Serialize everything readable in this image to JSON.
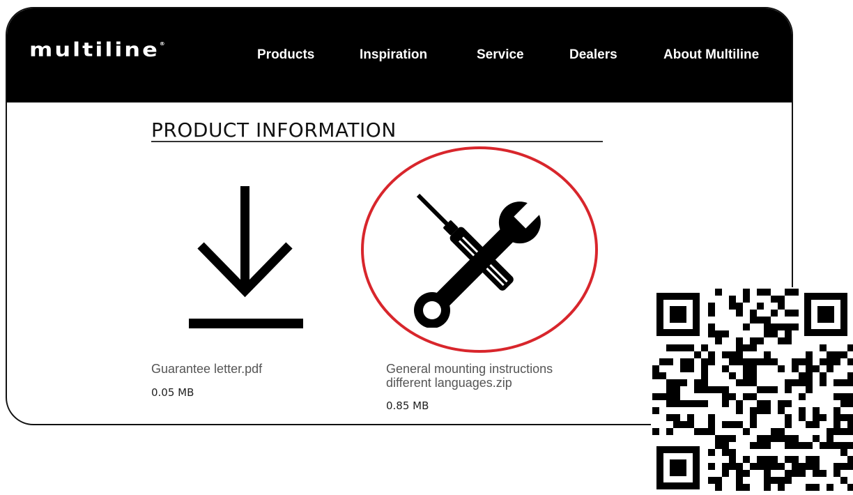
{
  "header": {
    "logo": "multiline",
    "logo_mark": "®",
    "nav": [
      "Products",
      "Inspiration",
      "Service",
      "Dealers",
      "About Multiline"
    ]
  },
  "section": {
    "title": "PRODUCT INFORMATION"
  },
  "files": [
    {
      "name": "Guarantee letter.pdf",
      "size": "0.05 MB",
      "icon": "download-icon"
    },
    {
      "name_line1": "General mounting instructions",
      "name_line2": "different languages.zip",
      "size": "0.85 MB",
      "icon": "tools-icon"
    }
  ],
  "colors": {
    "nav_bg": "#000000",
    "highlight_circle": "#d8262c",
    "text_gray": "#555555"
  },
  "qr_code": {
    "icon": "qr-code"
  }
}
